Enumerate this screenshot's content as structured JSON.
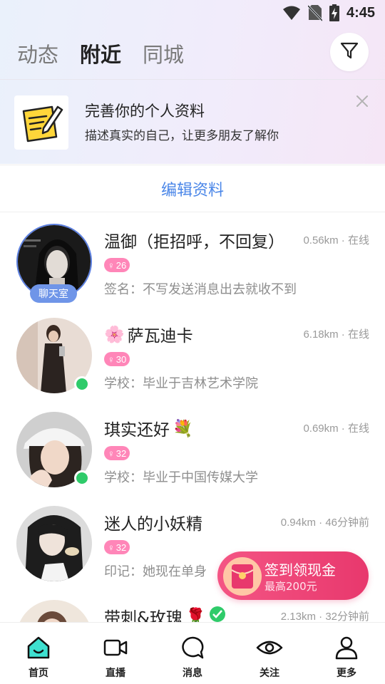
{
  "status_bar": {
    "time": "4:45"
  },
  "header": {
    "tabs": [
      {
        "label": "动态"
      },
      {
        "label": "附近"
      },
      {
        "label": "同城"
      }
    ],
    "active_tab": "附近"
  },
  "profile_banner": {
    "title": "完善你的个人资料",
    "subtitle": "描述真实的自己，让更多朋友了解你"
  },
  "edit_profile": {
    "label": "编辑资料"
  },
  "users": [
    {
      "name": "温御（拒招呼，不回复）",
      "distance": "0.56km",
      "status": "在线",
      "age": "26",
      "bio": "签名：不写发送消息出去就收不到",
      "tag": "聊天室",
      "emoji_suffix": ""
    },
    {
      "name": "萨瓦迪卡",
      "distance": "6.18km",
      "status": "在线",
      "age": "30",
      "bio": "学校：毕业于吉林艺术学院",
      "emoji_prefix": "🌸"
    },
    {
      "name": "琪实还好",
      "distance": "0.69km",
      "status": "在线",
      "age": "32",
      "bio": "学校：毕业于中国传媒大学",
      "emoji_suffix": "💐"
    },
    {
      "name": "迷人的小妖精",
      "distance": "0.94km",
      "status": "46分钟前",
      "age": "32",
      "bio": "印记：她现在单身"
    },
    {
      "name": "带刺&玫瑰",
      "distance": "2.13km",
      "status": "32分钟前",
      "emoji_suffix": "🌹"
    }
  ],
  "checkin": {
    "title": "签到领现金",
    "subtitle": "最高200元"
  },
  "bottom_nav": [
    {
      "label": "首页"
    },
    {
      "label": "直播"
    },
    {
      "label": "消息"
    },
    {
      "label": "关注"
    },
    {
      "label": "更多"
    }
  ],
  "colors": {
    "accent_blue": "#4a86e8",
    "online_green": "#2fcb6a",
    "age_badge_pink": "#ff86b8",
    "checkin_red": "#e8386d",
    "home_icon_teal": "#3ee0d0"
  }
}
